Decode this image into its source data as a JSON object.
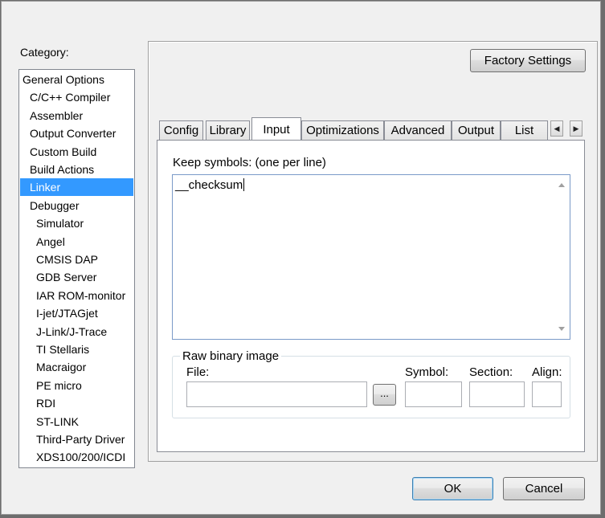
{
  "category": {
    "label": "Category:",
    "items": [
      {
        "label": "General Options",
        "indent": 0,
        "selected": false
      },
      {
        "label": "C/C++ Compiler",
        "indent": 1,
        "selected": false
      },
      {
        "label": "Assembler",
        "indent": 1,
        "selected": false
      },
      {
        "label": "Output Converter",
        "indent": 1,
        "selected": false
      },
      {
        "label": "Custom Build",
        "indent": 1,
        "selected": false
      },
      {
        "label": "Build Actions",
        "indent": 1,
        "selected": false
      },
      {
        "label": "Linker",
        "indent": 1,
        "selected": true
      },
      {
        "label": "Debugger",
        "indent": 1,
        "selected": false
      },
      {
        "label": "Simulator",
        "indent": 2,
        "selected": false
      },
      {
        "label": "Angel",
        "indent": 2,
        "selected": false
      },
      {
        "label": "CMSIS DAP",
        "indent": 2,
        "selected": false
      },
      {
        "label": "GDB Server",
        "indent": 2,
        "selected": false
      },
      {
        "label": "IAR ROM-monitor",
        "indent": 2,
        "selected": false
      },
      {
        "label": "I-jet/JTAGjet",
        "indent": 2,
        "selected": false
      },
      {
        "label": "J-Link/J-Trace",
        "indent": 2,
        "selected": false
      },
      {
        "label": "TI Stellaris",
        "indent": 2,
        "selected": false
      },
      {
        "label": "Macraigor",
        "indent": 2,
        "selected": false
      },
      {
        "label": "PE micro",
        "indent": 2,
        "selected": false
      },
      {
        "label": "RDI",
        "indent": 2,
        "selected": false
      },
      {
        "label": "ST-LINK",
        "indent": 2,
        "selected": false
      },
      {
        "label": "Third-Party Driver",
        "indent": 2,
        "selected": false
      },
      {
        "label": "XDS100/200/ICDI",
        "indent": 2,
        "selected": false
      }
    ]
  },
  "factory_settings_label": "Factory Settings",
  "tabs": [
    "Config",
    "Library",
    "Input",
    "Optimizations",
    "Advanced",
    "Output",
    "List"
  ],
  "active_tab": "Input",
  "input": {
    "keep_symbols_label": "Keep symbols: (one per line)",
    "keep_symbols_value": "__checksum",
    "raw_binary": {
      "title": "Raw binary image",
      "file_label": "File:",
      "file_value": "",
      "browse_label": "...",
      "symbol_label": "Symbol:",
      "symbol_value": "",
      "section_label": "Section:",
      "section_value": "",
      "align_label": "Align:",
      "align_value": ""
    }
  },
  "ok_label": "OK",
  "cancel_label": "Cancel",
  "colors": {
    "selection": "#3399ff",
    "default_button_border": "#3c7fb1"
  }
}
